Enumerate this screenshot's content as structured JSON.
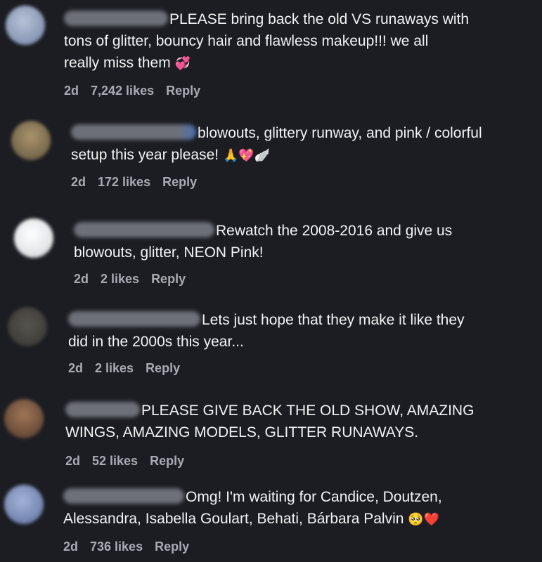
{
  "comments": [
    {
      "text": "PLEASE bring back the old VS runaways with",
      "text2": "tons of glitter, bouncy hair and flawless makeup!!! we all",
      "text3": "really miss them ",
      "emoji": "💞",
      "time": "2d",
      "likes": "7,242 likes",
      "reply": "Reply",
      "avatar_color": "#9aa8c4"
    },
    {
      "text": "blowouts, glittery runway, and pink / colorful",
      "text2": "setup this year please! ",
      "emoji": "🙏💖🪽",
      "time": "2d",
      "likes": "172 likes",
      "reply": "Reply",
      "avatar_color": "#8a7a5c"
    },
    {
      "text": "Rewatch the 2008-2016 and give us",
      "text2": "blowouts, glitter, NEON Pink!",
      "time": "2d",
      "likes": "2 likes",
      "reply": "Reply",
      "avatar_color": "#e6e7ea"
    },
    {
      "text": "Lets just hope that they make it like they",
      "text2": "did in the 2000s this year...",
      "time": "2d",
      "likes": "2 likes",
      "reply": "Reply",
      "avatar_color": "#46443f"
    },
    {
      "text": "PLEASE GIVE BACK THE OLD SHOW, AMAZING",
      "text2": "WINGS, AMAZING MODELS, GLITTER RUNAWAYS.",
      "time": "2d",
      "likes": "52 likes",
      "reply": "Reply",
      "avatar_color": "#7a5a44"
    },
    {
      "text": "Omg! I'm waiting for Candice, Doutzen,",
      "text2": "Alessandra, Isabella Goulart, Behati, Bárbara Palvin ",
      "emoji": "🥺❤️",
      "time": "2d",
      "likes": "736 likes",
      "reply": "Reply",
      "avatar_color": "#7d8fb8"
    }
  ],
  "colors": {
    "background": "#1c1d22",
    "text": "#f2f3f5",
    "meta": "#a8abb3",
    "blurred_username": "#6e7078"
  }
}
